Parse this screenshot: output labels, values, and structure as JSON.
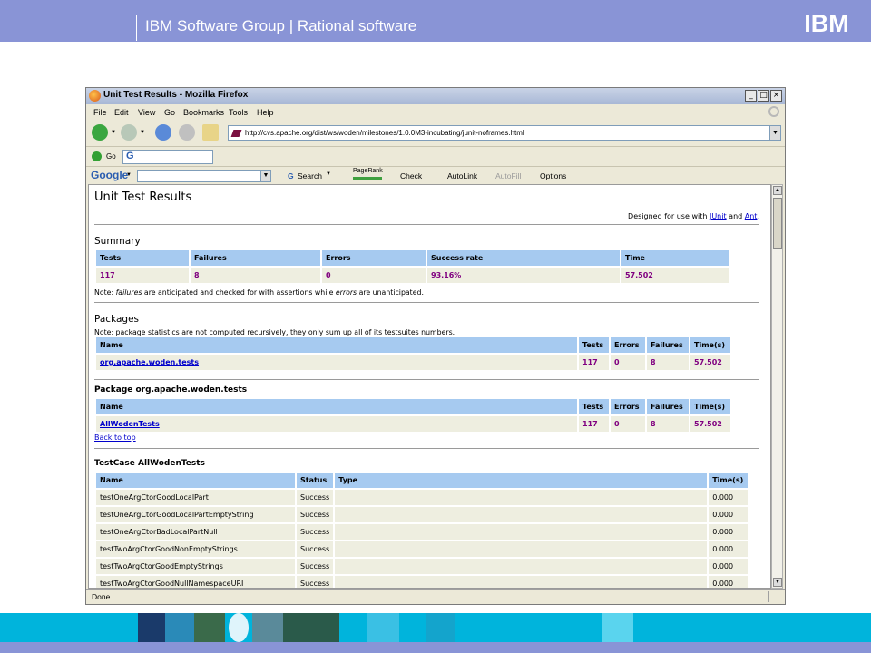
{
  "slide": {
    "header_title": "IBM Software Group | Rational software",
    "logo_text": "IBM",
    "header_color": "#8994d6",
    "footer_color": "#00b4dc"
  },
  "browser": {
    "window_title": "Unit Test Results - Mozilla Firefox",
    "window_buttons": [
      "_",
      "□",
      "×"
    ],
    "menu": [
      "File",
      "Edit",
      "View",
      "Go",
      "Bookmarks",
      "Tools",
      "Help"
    ],
    "url": "http://cvs.apache.org/dist/ws/woden/milestones/1.0.0M3-incubating/junit-noframes.html",
    "go_label": "Go",
    "google_toolbar": {
      "logo": "Google",
      "search_label": "Search",
      "pagerank_label": "PageRank",
      "check_label": "Check",
      "autolink_label": "AutoLink",
      "autofill_label": "AutoFill",
      "options_label": "Options"
    },
    "status": "Done"
  },
  "page": {
    "title": "Unit Test Results",
    "designed_prefix": "Designed for use with ",
    "junit_link": "JUnit",
    "and_text": " and ",
    "ant_link": "Ant",
    "period": ".",
    "summary": {
      "heading": "Summary",
      "headers": [
        "Tests",
        "Failures",
        "Errors",
        "Success rate",
        "Time"
      ],
      "values": [
        "117",
        "8",
        "0",
        "93.16%",
        "57.502"
      ],
      "note_prefix": "Note: ",
      "note_failures": "failures",
      "note_mid": " are anticipated and checked for with assertions while ",
      "note_errors": "errors",
      "note_suffix": " are unanticipated."
    },
    "packages": {
      "heading": "Packages",
      "note": "Note: package statistics are not computed recursively, they only sum up all of its testsuites numbers.",
      "headers": [
        "Name",
        "Tests",
        "Errors",
        "Failures",
        "Time(s)"
      ],
      "row": [
        "org.apache.woden.tests",
        "117",
        "0",
        "8",
        "57.502"
      ]
    },
    "package_detail": {
      "heading": "Package org.apache.woden.tests",
      "headers": [
        "Name",
        "Tests",
        "Errors",
        "Failures",
        "Time(s)"
      ],
      "row": [
        "AllWodenTests",
        "117",
        "0",
        "8",
        "57.502"
      ],
      "back_link": "Back to top"
    },
    "testcase": {
      "heading": "TestCase AllWodenTests",
      "headers": [
        "Name",
        "Status",
        "Type",
        "Time(s)"
      ],
      "rows": [
        [
          "testOneArgCtorGoodLocalPart",
          "Success",
          "",
          "0.000"
        ],
        [
          "testOneArgCtorGoodLocalPartEmptyString",
          "Success",
          "",
          "0.000"
        ],
        [
          "testOneArgCtorBadLocalPartNull",
          "Success",
          "",
          "0.000"
        ],
        [
          "testTwoArgCtorGoodNonEmptyStrings",
          "Success",
          "",
          "0.000"
        ],
        [
          "testTwoArgCtorGoodEmptyStrings",
          "Success",
          "",
          "0.000"
        ],
        [
          "testTwoArgCtorGoodNullNamespaceURI",
          "Success",
          "",
          "0.000"
        ]
      ]
    }
  }
}
